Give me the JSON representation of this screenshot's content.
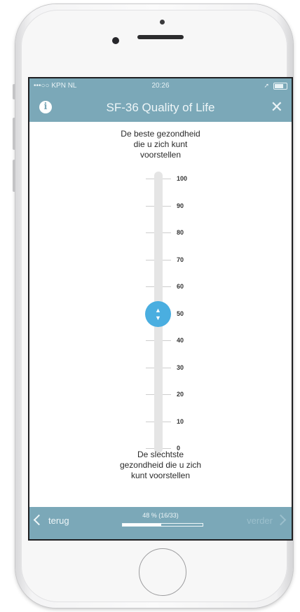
{
  "status_bar": {
    "carrier": "•••○○ KPN NL",
    "time": "20:26",
    "location": "➚"
  },
  "header": {
    "title": "SF-36 Quality of Life",
    "info_icon": "info-icon",
    "close_icon": "close-icon"
  },
  "question": {
    "top_label": [
      "De beste gezondheid",
      "die u zich kunt",
      "voorstellen"
    ],
    "bottom_label": [
      "De slechtste",
      "gezondheid die u zich",
      "kunt voorstellen"
    ]
  },
  "scale": {
    "labels": [
      "100",
      "90",
      "80",
      "70",
      "60",
      "50",
      "40",
      "30",
      "20",
      "10",
      "0"
    ],
    "value": 50,
    "accent_color": "#4aaee0"
  },
  "footer": {
    "back_label": "terug",
    "next_label": "verder",
    "progress_text": "48 % (16/33)",
    "progress_fraction": 0.48
  },
  "colors": {
    "bar": "#7ba8b8"
  }
}
